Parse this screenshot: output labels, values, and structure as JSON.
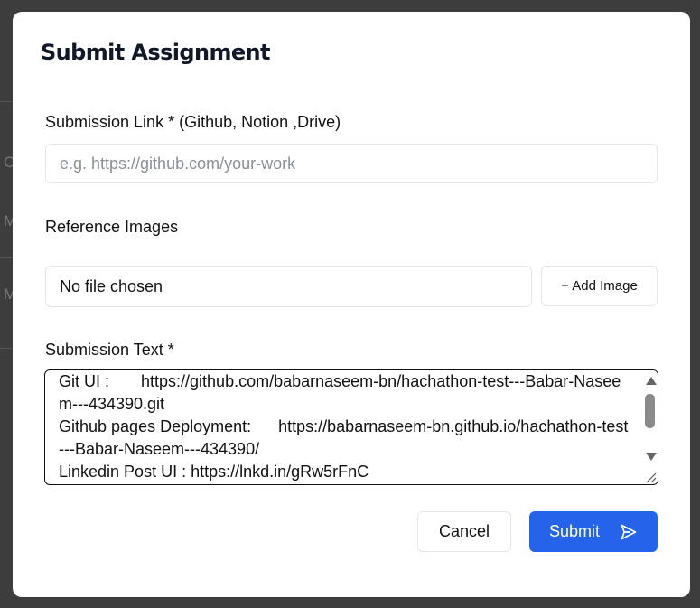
{
  "background": {
    "letters": [
      "C",
      "M",
      "M"
    ]
  },
  "modal": {
    "title": "Submit Assignment",
    "submission_link": {
      "label": "Submission Link * (Github, Notion ,Drive)",
      "placeholder": "e.g. https://github.com/your-work",
      "value": ""
    },
    "reference_images": {
      "label": "Reference Images",
      "file_status": "No file chosen",
      "add_button_label": "+ Add Image"
    },
    "submission_text": {
      "label": "Submission Text *",
      "value": "Git UI :       https://github.com/babarnaseem-bn/hachathon-test---Babar-Naseem---434390.git\nGithub pages Deployment:      https://babarnaseem-bn.github.io/hachathon-test---Babar-Naseem---434390/\nLinkedin Post UI : https://lnkd.in/gRw5rFnC"
    },
    "actions": {
      "cancel_label": "Cancel",
      "submit_label": "Submit",
      "submit_icon": "send-icon"
    }
  },
  "colors": {
    "overlay": "#3a3a3a",
    "primary": "#2563eb",
    "border": "#e3e5e8",
    "text": "#111111",
    "placeholder": "#8a8f98"
  }
}
